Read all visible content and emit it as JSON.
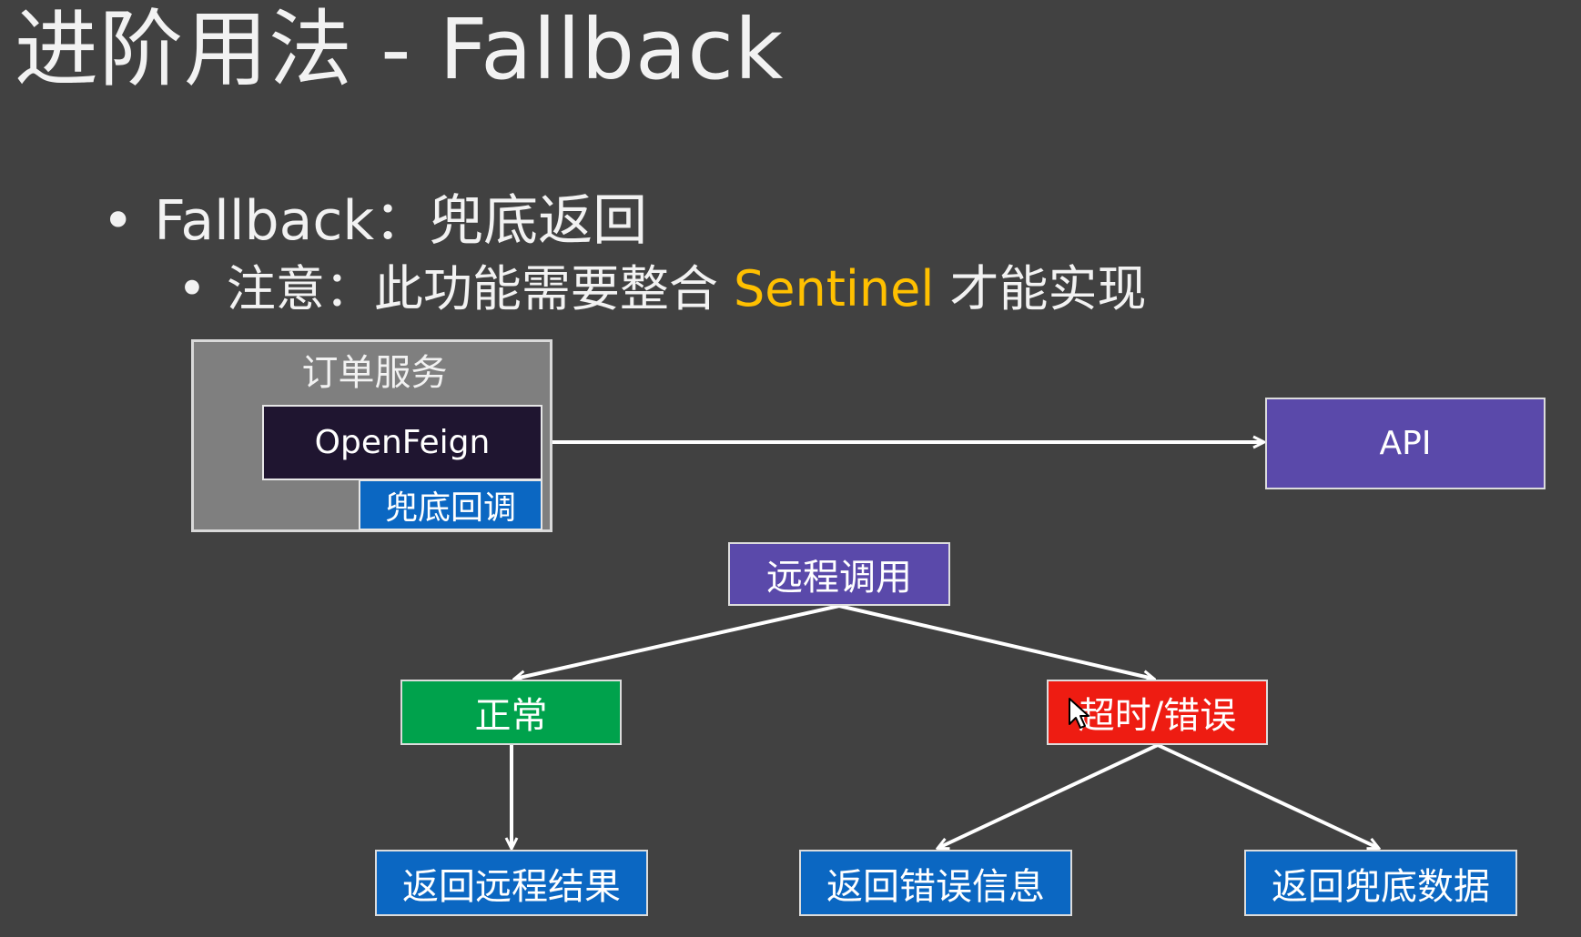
{
  "slide": {
    "title": "进阶用法 - Fallback"
  },
  "bullets": {
    "level1_dot": "•",
    "level1_text": "Fallback：兜底返回",
    "level2_dot": "•",
    "level2_prefix": "注意：此功能需要整合 ",
    "level2_highlight": "Sentinel",
    "level2_suffix": " 才能实现"
  },
  "diagram": {
    "service_title": "订单服务",
    "openfeign": "OpenFeign",
    "fallback_callback": "兜底回调",
    "api": "API",
    "remote_call": "远程调用",
    "normal": "正常",
    "timeout_error": "超时/错误",
    "return_remote": "返回远程结果",
    "return_error": "返回错误信息",
    "return_fallback": "返回兜底数据"
  },
  "colors": {
    "background": "#414141",
    "highlight": "#ffc000",
    "purple": "#5a49aa",
    "green": "#00a24c",
    "red": "#ee1c12",
    "blue": "#0b67c2",
    "dark": "#1f1530",
    "gray": "#7f7f7f"
  },
  "icons": {
    "cursor": "mouse-pointer-icon"
  }
}
